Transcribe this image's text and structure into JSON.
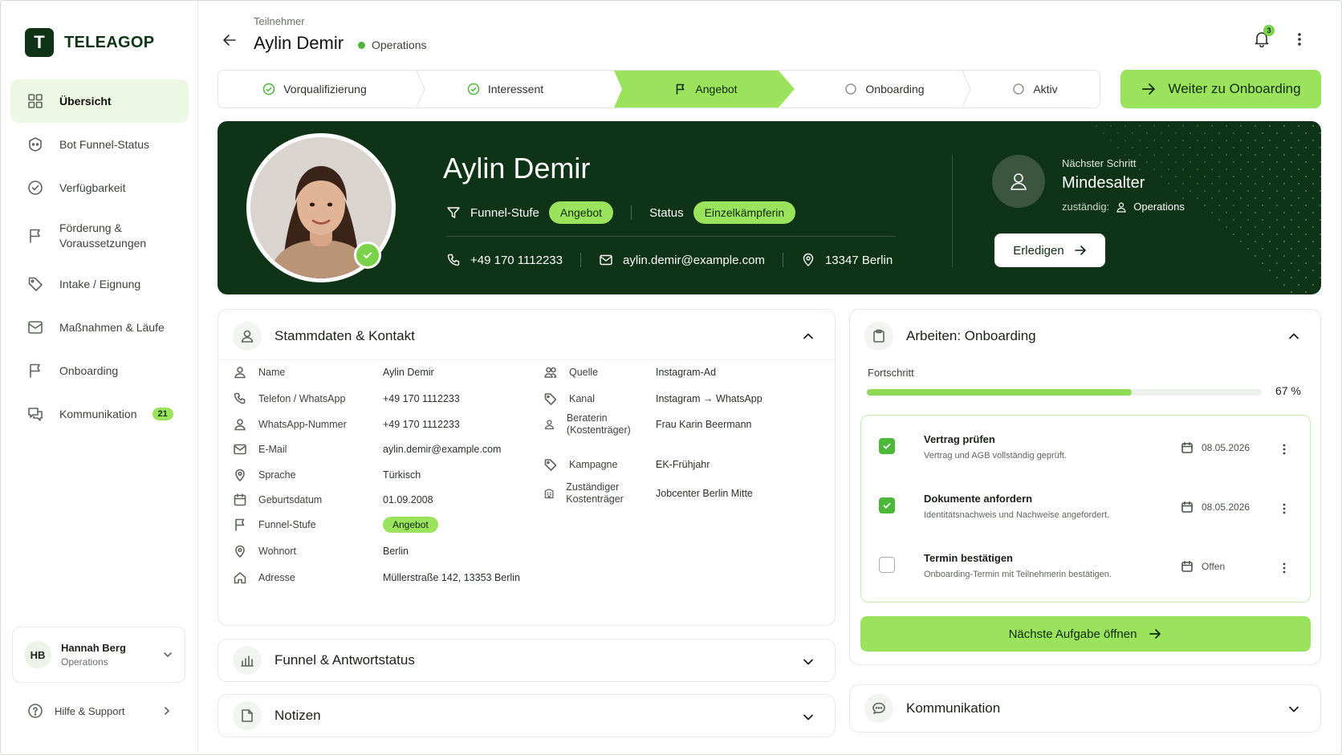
{
  "app": {
    "logo_letter": "T",
    "name": "TELEAGOP"
  },
  "sidebar": {
    "items": [
      {
        "label": "Übersicht",
        "icon": "grid-icon",
        "active": true
      },
      {
        "label": "Bot Funnel-Status",
        "icon": "bot-icon"
      },
      {
        "label": "Verfügbarkeit",
        "icon": "check-circle-icon"
      },
      {
        "label": "Förderung & Voraussetzungen",
        "icon": "flag-icon"
      },
      {
        "label": "Intake / Eignung",
        "icon": "tag-icon"
      },
      {
        "label": "Maßnahmen & Läufe",
        "icon": "mail-icon"
      },
      {
        "label": "Onboarding",
        "icon": "flag-icon"
      },
      {
        "label": "Kommunikation",
        "icon": "chat-icon",
        "badge": "21"
      }
    ],
    "user": {
      "initials": "HB",
      "name": "Hannah Berg",
      "role": "Operations"
    },
    "help": "Hilfe & Support"
  },
  "header": {
    "breadcrumb": "Teilnehmer",
    "title": "Aylin Demir",
    "department": "Operations",
    "notification_count": "3"
  },
  "stepper": {
    "steps": [
      {
        "label": "Vorqualifizierung",
        "state": "done"
      },
      {
        "label": "Interessent",
        "state": "done"
      },
      {
        "label": "Angebot",
        "state": "active"
      },
      {
        "label": "Onboarding",
        "state": "todo"
      },
      {
        "label": "Aktiv",
        "state": "todo"
      }
    ],
    "cta": "Weiter zu Onboarding"
  },
  "hero": {
    "name": "Aylin Demir",
    "funnel_label": "Funnel-Stufe",
    "funnel_value": "Angebot",
    "status_label": "Status",
    "status_value": "Einzelkämpferin",
    "phone": "+49 170 1112233",
    "email": "aylin.demir@example.com",
    "location": "13347 Berlin",
    "next_label": "Nächster Schritt",
    "next_title": "Mindesalter",
    "next_owner_label": "zuständig:",
    "next_owner": "Operations",
    "done_button": "Erledigen"
  },
  "stammdaten": {
    "title": "Stammdaten & Kontakt",
    "left": [
      {
        "icon": "user-icon",
        "key": "Name",
        "value": "Aylin Demir"
      },
      {
        "icon": "phone-icon",
        "key": "Telefon / WhatsApp",
        "value": "+49 170 1112233"
      },
      {
        "icon": "user-icon",
        "key": "WhatsApp-Nummer",
        "value": "+49 170 1112233"
      },
      {
        "icon": "mail-icon",
        "key": "E-Mail",
        "value": "aylin.demir@example.com"
      },
      {
        "icon": "pin-icon",
        "key": "Sprache",
        "value": "Türkisch"
      },
      {
        "icon": "calendar-icon",
        "key": "Geburtsdatum",
        "value": "01.09.2008"
      },
      {
        "icon": "flag-icon",
        "key": "Funnel-Stufe",
        "value": "Angebot",
        "pill": true
      },
      {
        "icon": "pin-icon",
        "key": "Wohnort",
        "value": "Berlin"
      },
      {
        "icon": "home-icon",
        "key": "Adresse",
        "value": "Müllerstraße 142, 13353 Berlin"
      }
    ],
    "right": [
      {
        "icon": "users-icon",
        "key": "Quelle",
        "value": "Instagram-Ad"
      },
      {
        "icon": "tag-icon",
        "key": "Kanal",
        "value": "Instagram → WhatsApp"
      },
      {
        "icon": "user-icon",
        "key": "Beraterin (Kostenträger)",
        "value": "Frau Karin Beermann"
      },
      {
        "icon": "tag-icon",
        "key": "Kampagne",
        "value": "EK-Frühjahr"
      },
      {
        "icon": "building-icon",
        "key": "Zuständiger Kostenträger",
        "value": "Jobcenter Berlin Mitte"
      }
    ]
  },
  "funnel_section": {
    "title": "Funnel & Antwortstatus"
  },
  "notes_section": {
    "title": "Notizen"
  },
  "onboarding": {
    "title": "Arbeiten: Onboarding",
    "progress_label": "Fortschritt",
    "progress_value": 0.67,
    "progress_text": "67 %",
    "tasks": [
      {
        "title": "Vertrag prüfen",
        "desc": "Vertrag und AGB vollständig geprüft.",
        "date": "08.05.2026",
        "done": true
      },
      {
        "title": "Dokumente anfordern",
        "desc": "Identitätsnachweis und Nachweise angefordert.",
        "date": "08.05.2026",
        "done": true
      },
      {
        "title": "Termin bestätigen",
        "desc": "Onboarding-Termin mit Teilnehmerin bestätigen.",
        "date": "Offen",
        "done": false
      }
    ],
    "cta": "Nächste Aufgabe öffnen"
  },
  "kommunikation_section": {
    "title": "Kommunikation"
  },
  "colors": {
    "brand_dark": "#0f3317",
    "accent": "#9be35c",
    "status_dot": "#4fb53a"
  }
}
